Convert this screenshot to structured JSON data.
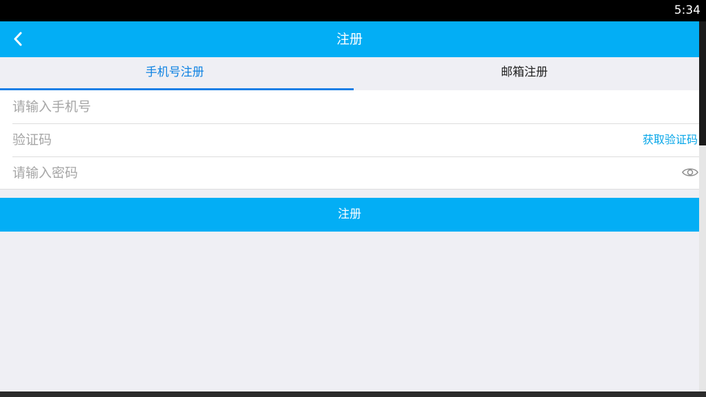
{
  "status_bar": {
    "time": "5:34"
  },
  "app_bar": {
    "title": "注册",
    "back_icon": "chevron-left-icon"
  },
  "tabs": [
    {
      "label": "手机号注册",
      "active": true
    },
    {
      "label": "邮箱注册",
      "active": false
    }
  ],
  "form": {
    "phone": {
      "placeholder": "请输入手机号",
      "value": ""
    },
    "code": {
      "placeholder": "验证码",
      "value": "",
      "action_label": "获取验证码"
    },
    "password": {
      "placeholder": "请输入密码",
      "value": "",
      "toggle_icon": "eye-icon"
    }
  },
  "register_button": {
    "label": "注册"
  },
  "colors": {
    "primary": "#03aef5",
    "tab_active": "#0e82e2",
    "link": "#06a6e8",
    "background": "#efeff4"
  }
}
